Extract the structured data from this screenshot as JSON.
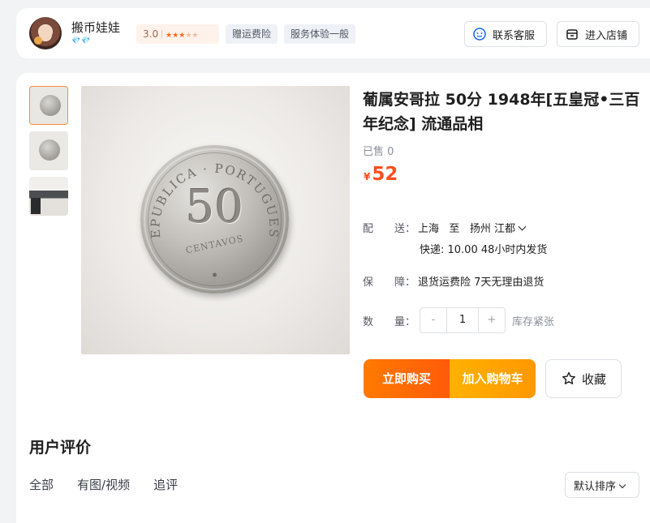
{
  "shop": {
    "name": "搬币娃娃",
    "level_badge": "💎💎",
    "rating": "3.0",
    "stars_filled": 3,
    "stars_total": 5,
    "tag_insurance": "赠运费险",
    "tag_service": "服务体验一般",
    "contact_label": "联系客服",
    "store_label": "进入店铺"
  },
  "product": {
    "title": "葡属安哥拉 50分 1948年[五皇冠•三百年纪念] 流通品相",
    "sold": "已售 0",
    "currency": "¥",
    "price": "52",
    "coin_value": "50",
    "coin_unit": "CENTAVOS",
    "coin_legend": "REPUBLICA · PORTUGUESA"
  },
  "shipping": {
    "label": "配　　送：",
    "from": "上海",
    "to_word": "至",
    "to": "扬州 江都",
    "detail": "快递: 10.00  48小时内发货"
  },
  "guarantee": {
    "label": "保　　障：",
    "text": "退货运费险 7天无理由退货"
  },
  "quantity": {
    "label": "数　　量：",
    "minus": "-",
    "value": "1",
    "plus": "+",
    "stock": "库存紧张"
  },
  "actions": {
    "buy": "立即购买",
    "cart": "加入购物车",
    "favorite": "收藏"
  },
  "reviews": {
    "title": "用户评价",
    "tabs": [
      "全部",
      "有图/视频",
      "追评"
    ],
    "sort": "默认排序"
  },
  "colors": {
    "accent": "#ff4f1f",
    "buy_button": "#ff6a00",
    "cart_button": "#ffa800"
  }
}
